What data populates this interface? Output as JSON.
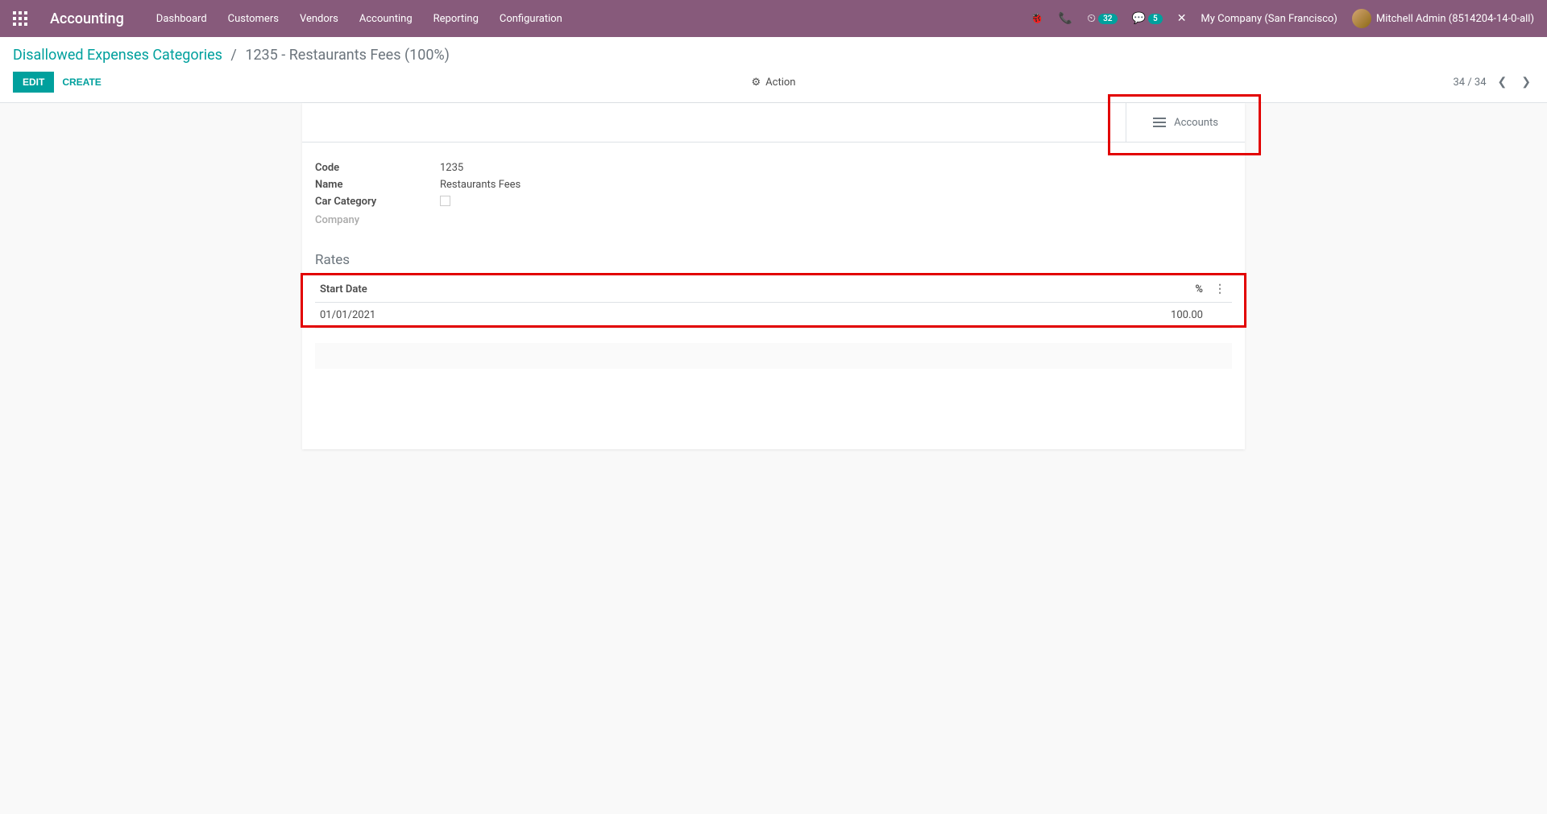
{
  "nav": {
    "app_title": "Accounting",
    "menu": [
      "Dashboard",
      "Customers",
      "Vendors",
      "Accounting",
      "Reporting",
      "Configuration"
    ],
    "badge_activities": "32",
    "badge_discuss": "5",
    "company": "My Company (San Francisco)",
    "user": "Mitchell Admin (8514204-14-0-all)"
  },
  "breadcrumb": {
    "parent": "Disallowed Expenses Categories",
    "current": "1235 - Restaurants Fees (100%)"
  },
  "controls": {
    "edit": "EDIT",
    "create": "CREATE",
    "action": "Action",
    "pager": "34 / 34"
  },
  "stat_button": {
    "label": "Accounts"
  },
  "fields": {
    "code_label": "Code",
    "code_value": "1235",
    "name_label": "Name",
    "name_value": "Restaurants Fees",
    "car_label": "Car Category",
    "company_label": "Company"
  },
  "rates": {
    "title": "Rates",
    "col_start": "Start Date",
    "col_pct": "%",
    "rows": [
      {
        "date": "01/01/2021",
        "pct": "100.00"
      }
    ]
  }
}
